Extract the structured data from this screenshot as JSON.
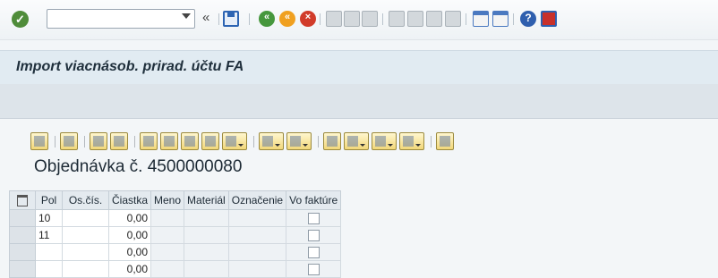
{
  "toolbar": {
    "command_value": "",
    "ok_icon": "check-icon",
    "back_glyph": "«",
    "icons": [
      "save-icon",
      "back-icon",
      "exit-icon",
      "cancel-icon",
      "print-icon",
      "find-icon",
      "find-next-icon",
      "first-page-icon",
      "previous-page-icon",
      "next-page-icon",
      "last-page-icon",
      "create-session-icon",
      "shortcut-icon",
      "help-icon",
      "customize-layout-icon"
    ]
  },
  "title": "Import viacnásob. prirad. účtu FA",
  "order_heading": "Objednávka č. 4500000080",
  "grid": {
    "columns": [
      "Pol",
      "Os.čís.",
      "Čiastka",
      "Meno",
      "Materiál",
      "Označenie",
      "Vo faktúre"
    ],
    "rows": [
      {
        "pol": "10",
        "os_cis": "",
        "castka": "0,00",
        "meno": "",
        "material": "",
        "oznacenie": "",
        "vo_fakture": false
      },
      {
        "pol": "11",
        "os_cis": "",
        "castka": "0,00",
        "meno": "",
        "material": "",
        "oznacenie": "",
        "vo_fakture": false
      },
      {
        "pol": "",
        "os_cis": "",
        "castka": "0,00",
        "meno": "",
        "material": "",
        "oznacenie": "",
        "vo_fakture": false
      },
      {
        "pol": "",
        "os_cis": "",
        "castka": "0,00",
        "meno": "",
        "material": "",
        "oznacenie": "",
        "vo_fakture": false
      }
    ]
  },
  "colors": {
    "title_bar": "#e1ebf2",
    "app_bar": "#dde4ea",
    "alv_button": "#f2d77a"
  }
}
